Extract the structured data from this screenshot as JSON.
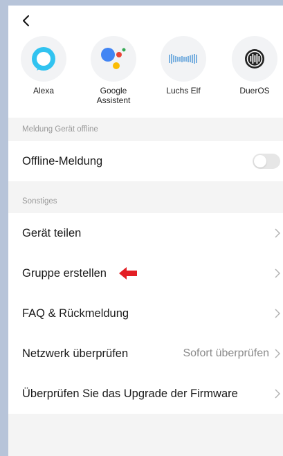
{
  "services": [
    {
      "label": "Alexa",
      "icon": "alexa-icon"
    },
    {
      "label": "Google\nAssistent",
      "icon": "google-assistant-icon"
    },
    {
      "label": "Luchs Elf",
      "icon": "luchs-elf-icon"
    },
    {
      "label": "DuerOS",
      "icon": "dueros-icon"
    }
  ],
  "offline_section": {
    "header": "Meldung Gerät offline",
    "row_label": "Offline-Meldung",
    "toggle_on": false
  },
  "other_section": {
    "header": "Sonstiges",
    "rows": [
      {
        "label": "Gerät teilen",
        "value": ""
      },
      {
        "label": "Gruppe erstellen",
        "value": ""
      },
      {
        "label": "FAQ & Rückmeldung",
        "value": ""
      },
      {
        "label": "Netzwerk überprüfen",
        "value": "Sofort überprüfen"
      },
      {
        "label": "Überprüfen Sie das Upgrade der Firmware",
        "value": ""
      }
    ]
  },
  "colors": {
    "outer_background": "#b7c4d9",
    "alexa_blue": "#31c3f0",
    "annotation_arrow_red": "#e31e24"
  }
}
